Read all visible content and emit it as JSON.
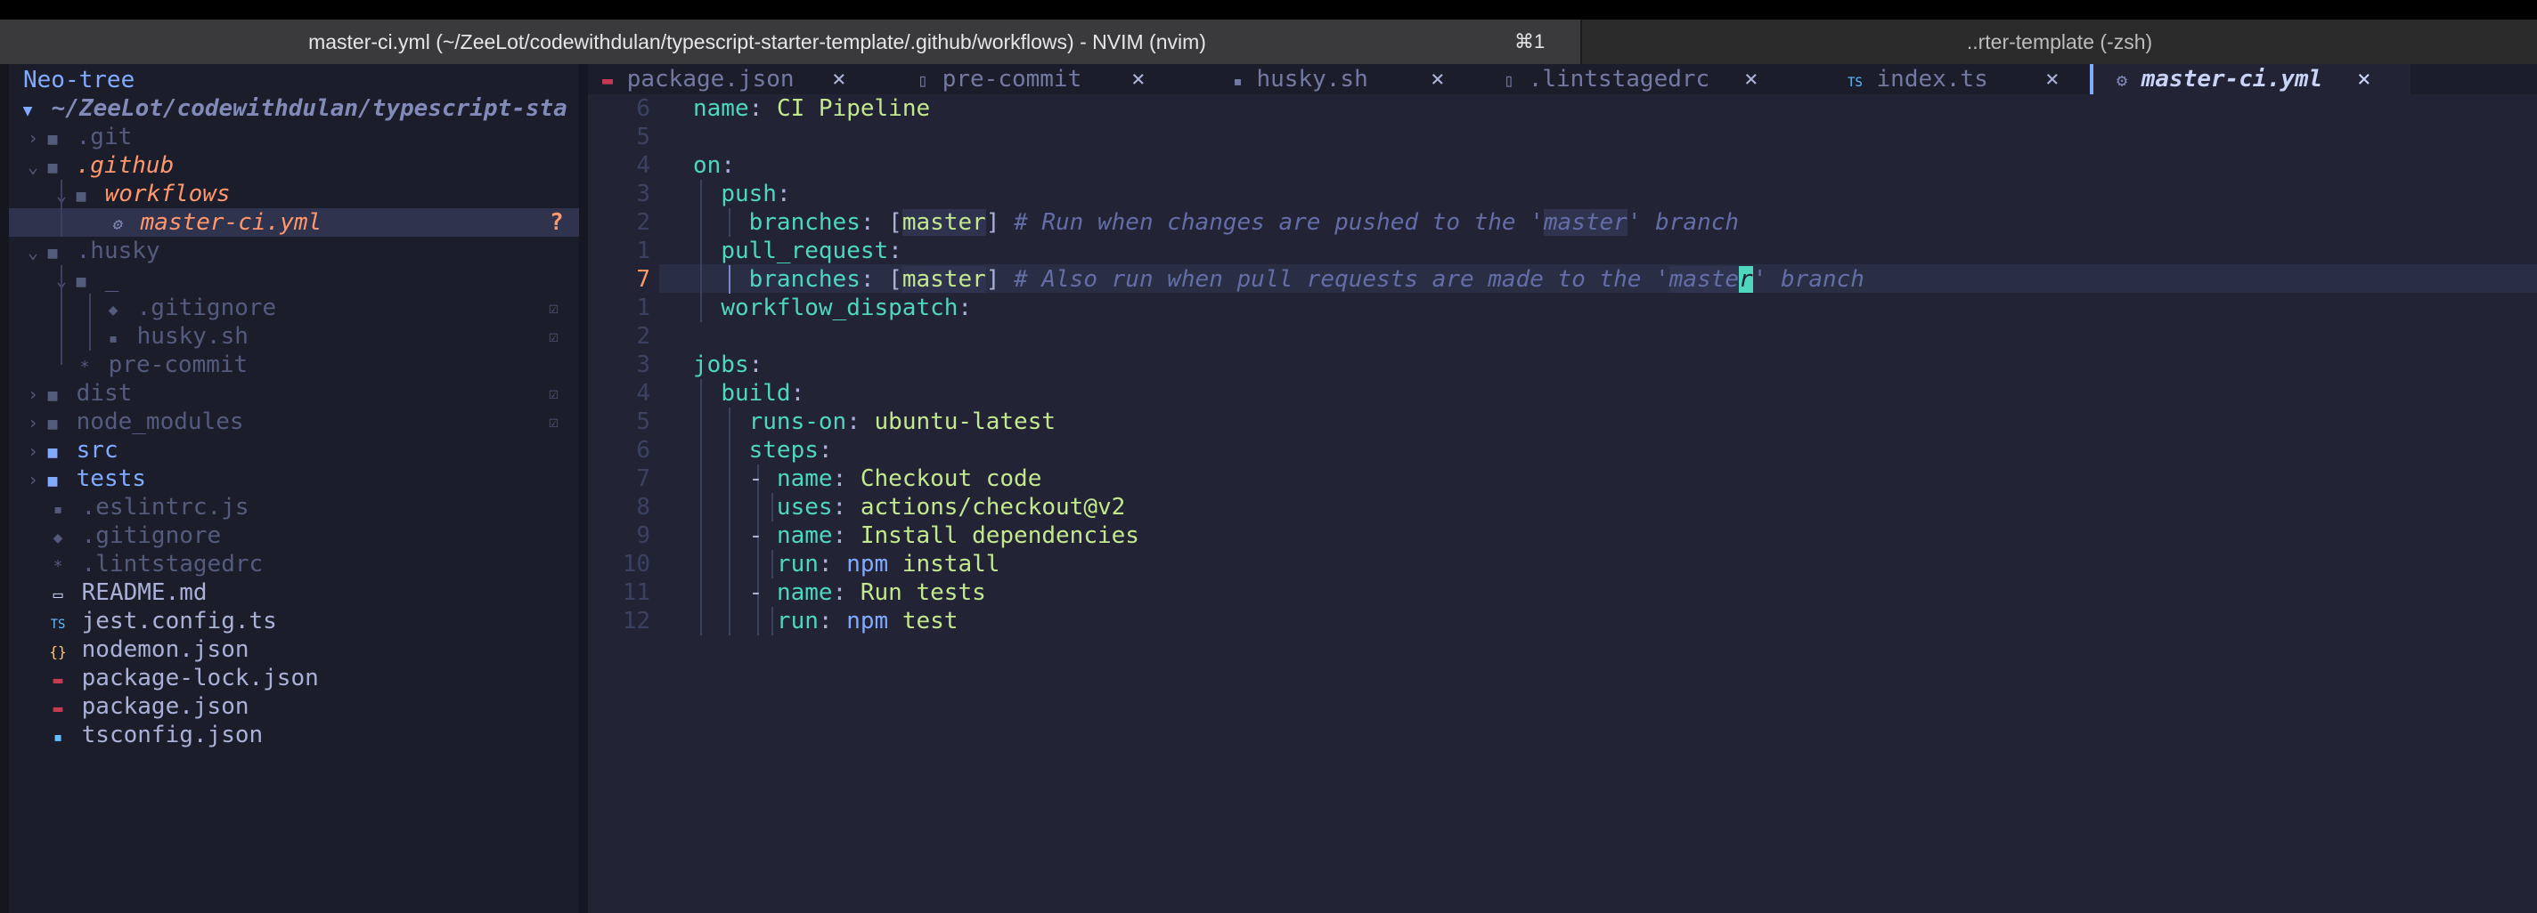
{
  "terminal": {
    "active_tab_title": "master-ci.yml (~/ZeeLot/codewithdulan/typescript-starter-template/.github/workflows) - NVIM (nvim)",
    "active_tab_shortcut": "⌘1",
    "other_tab_title": "..rter-template (-zsh)"
  },
  "sidebar": {
    "title": "Neo-tree",
    "root": "~/ZeeLot/codewithdulan/typescript-sta",
    "items": [
      {
        "label": ".git"
      },
      {
        "label": ".github"
      },
      {
        "label": "workflows"
      },
      {
        "label": "master-ci.yml",
        "badge": "?"
      },
      {
        "label": ".husky"
      },
      {
        "label": "_"
      },
      {
        "label": ".gitignore"
      },
      {
        "label": "husky.sh"
      },
      {
        "label": "pre-commit"
      },
      {
        "label": "dist"
      },
      {
        "label": "node_modules"
      },
      {
        "label": "src"
      },
      {
        "label": "tests"
      },
      {
        "label": ".eslintrc.js"
      },
      {
        "label": ".gitignore"
      },
      {
        "label": ".lintstagedrc"
      },
      {
        "label": "README.md"
      },
      {
        "label": "jest.config.ts"
      },
      {
        "label": "nodemon.json"
      },
      {
        "label": "package-lock.json"
      },
      {
        "label": "package.json"
      },
      {
        "label": "tsconfig.json"
      }
    ],
    "icons": {
      "folder": "folder-icon",
      "file": "file-icon",
      "gear": "gear-icon",
      "ignored": "ignored-check-icon"
    }
  },
  "tabs": [
    {
      "label": "package.json",
      "close": "×"
    },
    {
      "label": "pre-commit",
      "close": "×"
    },
    {
      "label": "husky.sh",
      "close": "×"
    },
    {
      "label": ".lintstagedrc",
      "close": "×"
    },
    {
      "label": "index.ts",
      "close": "×"
    },
    {
      "label": "master-ci.yml",
      "close": "×"
    }
  ],
  "editor": {
    "line_numbers": [
      "6",
      "5",
      "4",
      "3",
      "2",
      "1",
      "7",
      "1",
      "2",
      "3",
      "4",
      "5",
      "6",
      "7",
      "8",
      "9",
      "10",
      "11",
      "12"
    ],
    "lines": {
      "l1_key": "name",
      "l1_val": "CI Pipeline",
      "l3_key": "on",
      "l4_key": "push",
      "l5_key": "branches",
      "l5_branch": "master",
      "l5_comment_a": "# Run when changes are pushed to the '",
      "l5_comment_hl": "master",
      "l5_comment_b": "' branch",
      "l6_key": "pull_request",
      "l7_key": "branches",
      "l7_branch": "master",
      "l7_comment_a": "# Also run when pull requests are made to the '",
      "l7_comment_hl": "maste",
      "l7_cursor": "r",
      "l7_comment_b": "' branch",
      "l8_key": "workflow_dispatch",
      "l10_key": "jobs",
      "l11_key": "build",
      "l12_key": "runs-on",
      "l12_val": "ubuntu-latest",
      "l13_key": "steps",
      "l14_key": "name",
      "l14_val": "Checkout code",
      "l15_key": "uses",
      "l15_val": "actions/checkout@v2",
      "l16_key": "name",
      "l16_val": "Install dependencies",
      "l17_key": "run",
      "l17_cmd": "npm",
      "l17_arg": "install",
      "l18_key": "name",
      "l18_val": "Run tests",
      "l19_key": "run",
      "l19_cmd": "npm",
      "l19_arg": "test"
    }
  },
  "colors": {
    "background": "#222436",
    "accent": "#ff966c",
    "keyword": "#4fd6be",
    "string": "#c3e88d",
    "comment": "#636da6"
  }
}
